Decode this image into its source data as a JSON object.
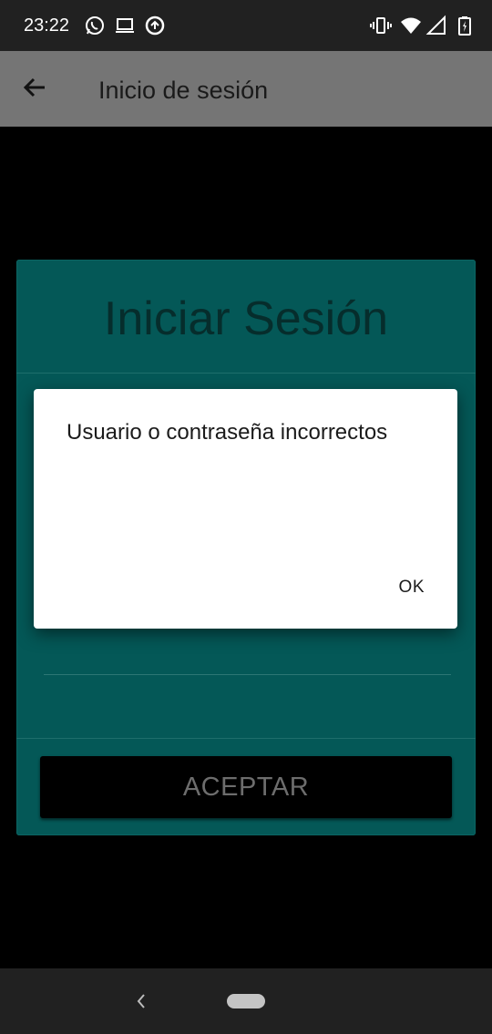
{
  "status_bar": {
    "time": "23:22",
    "icons_left": [
      "whatsapp-icon",
      "laptop-icon",
      "data-saver-icon"
    ],
    "icons_right": [
      "vibrate-icon",
      "wifi-icon",
      "signal-icon",
      "battery-icon"
    ]
  },
  "app_bar": {
    "title": "Inicio de sesión",
    "back_icon": "arrow-back-icon"
  },
  "login": {
    "title": "Iniciar Sesión",
    "accept_label": "ACEPTAR"
  },
  "dialog": {
    "message": "Usuario o contraseña incorrectos",
    "ok_label": "OK"
  },
  "nav_bar": {
    "back_icon": "nav-back-icon",
    "home_icon": "home-pill-icon"
  },
  "colors": {
    "card": "#045857",
    "app_bar": "#757575",
    "status_bar": "#212121",
    "dialog": "#ffffff"
  }
}
